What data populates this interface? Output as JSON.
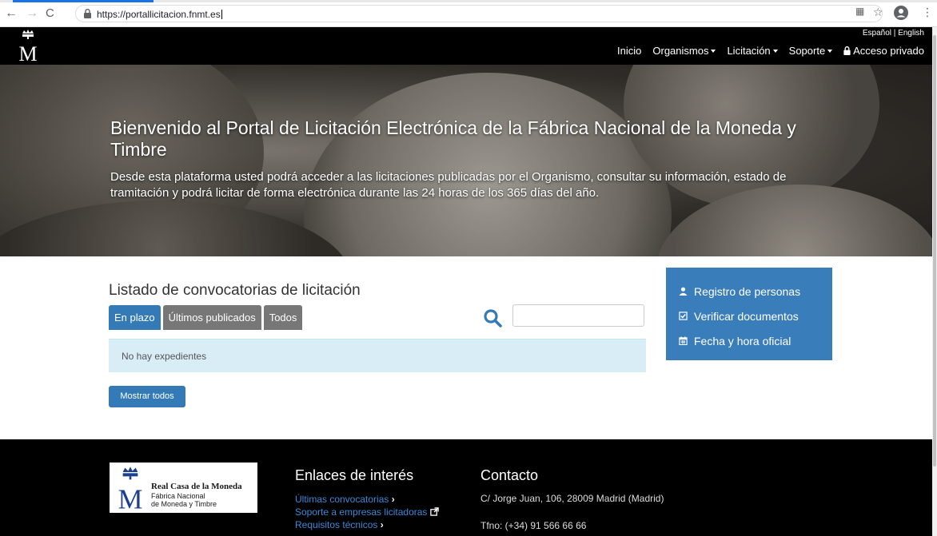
{
  "browser": {
    "url": "https://portallicitacion.fnmt.es"
  },
  "header": {
    "lang_es": "Español",
    "lang_sep": "|",
    "lang_en": "English",
    "nav": {
      "inicio": "Inicio",
      "organismos": "Organismos",
      "licitacion": "Licitación",
      "soporte": "Soporte",
      "acceso": "Acceso privado"
    }
  },
  "hero": {
    "title": "Bienvenido al Portal de Licitación Electrónica de la Fábrica Nacional de la Moneda y Timbre",
    "subtitle": "Desde esta plataforma usted podrá acceder a las licitaciones publicadas por el Organismo, consultar su información, estado de tramitación y podrá licitar de forma electrónica durante las 24 horas de los 365 días del año."
  },
  "listing": {
    "title": "Listado de convocatorias de licitación",
    "tabs": [
      "En plazo",
      "Últimos publicados",
      "Todos"
    ],
    "empty_message": "No hay expedientes",
    "show_all": "Mostrar todos"
  },
  "sidebar": {
    "items": [
      "Registro de personas",
      "Verificar documentos",
      "Fecha y hora oficial"
    ]
  },
  "footer": {
    "logo_line1": "Real Casa de la Moneda",
    "logo_line2": "Fábrica Nacional",
    "logo_line3": "de Moneda y Timbre",
    "links_title": "Enlaces de interés",
    "links": [
      "Últimas convocatorias",
      "Soporte a empresas licitadoras",
      "Requisitos técnicos"
    ],
    "contact_title": "Contacto",
    "address": "C/ Jorge Juan, 106, 28009 Madrid (Madrid)",
    "phone": "Tfno: (+34) 91 566 66 66"
  },
  "colors": {
    "primary": "#337ab7",
    "header_bg": "#000000",
    "alert_bg": "#d9edf7",
    "tab_inactive": "#777777"
  }
}
